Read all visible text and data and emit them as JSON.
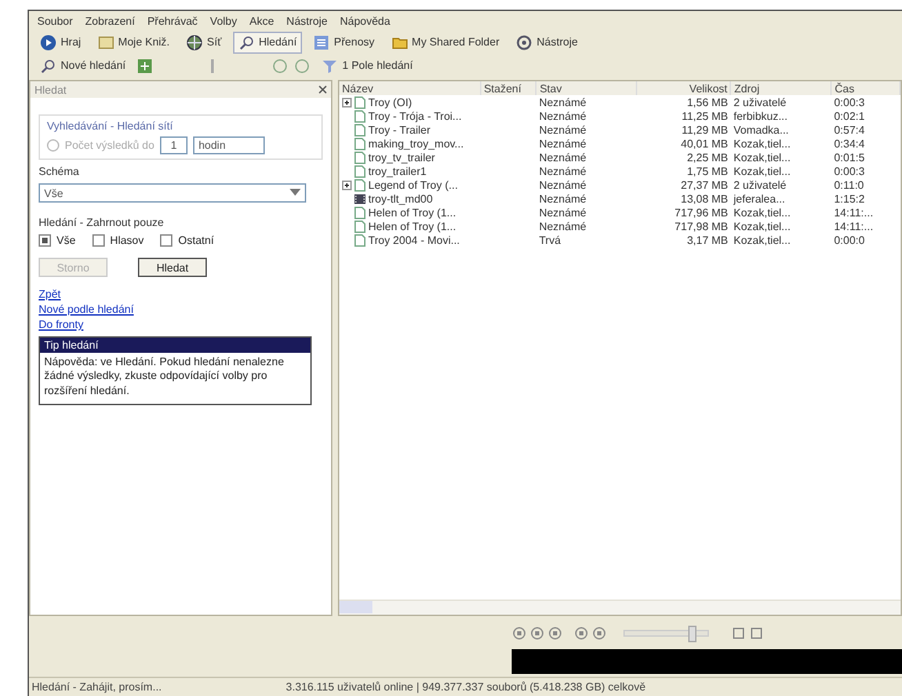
{
  "menu": [
    "Soubor",
    "Zobrazení",
    "Přehrávač",
    "Volby",
    "Akce",
    "Nástroje",
    "Nápověda"
  ],
  "toolbar": [
    {
      "label": "Hraj",
      "selected": false
    },
    {
      "label": "Moje Kniž.",
      "selected": false
    },
    {
      "label": "Síť",
      "selected": false
    },
    {
      "label": "Hledání",
      "selected": true
    },
    {
      "label": "Přenosy",
      "selected": false
    },
    {
      "label": "My Shared Folder",
      "selected": false
    },
    {
      "label": "Nástroje",
      "selected": false
    }
  ],
  "player": {
    "volume": {
      "level": 0.8
    }
  },
  "toolbar2": {
    "new_search": "Nové hledání",
    "filter": "1 Pole hledání"
  },
  "search_panel": {
    "title": "Hledat",
    "options_label": "Vyhledávání - Hledání sítí",
    "radio": {
      "label": "Počet výsledků do",
      "selected": false
    },
    "count": "1",
    "unit": "hodin",
    "schema_label": "Schéma",
    "schema_value": "Vše",
    "filter_label": "Hledání - Zahrnout pouze",
    "checkboxes": [
      {
        "label": "Vše",
        "checked": true
      },
      {
        "label": "Hlasov",
        "checked": false
      },
      {
        "label": "Ostatní",
        "checked": false
      }
    ],
    "buttons": [
      {
        "label": "Storno",
        "disabled": true
      },
      {
        "label": "Hledat",
        "disabled": false
      }
    ],
    "links": [
      "Zpět",
      "Nové podle hledání",
      "Do fronty"
    ],
    "tip": {
      "title": "Tip hledání",
      "text": "Nápověda: ve Hledání. Pokud hledání nenalezne žádné výsledky, zkuste odpovídající volby pro rozšíření hledání."
    }
  },
  "results": {
    "columns": [
      "Název",
      "Stažení",
      "Stav",
      "Velikost",
      "Zdroj",
      "Čas"
    ],
    "rows": [
      {
        "kind": "group",
        "name": "Troy (OI)",
        "status": "Neznámé",
        "size": "1,56 MB",
        "source": "2 uživatelé",
        "time": "0:00:3"
      },
      {
        "kind": "file",
        "name": "Troy - Trója - Troi...",
        "status": "Neznámé",
        "size": "11,25 MB",
        "source": "ferbibkuz...",
        "time": "0:02:1"
      },
      {
        "kind": "file",
        "name": "Troy - Trailer",
        "status": "Neznámé",
        "size": "11,29 MB",
        "source": "Vomadka...",
        "time": "0:57:4"
      },
      {
        "kind": "file",
        "name": "making_troy_mov...",
        "status": "Neznámé",
        "size": "40,01 MB",
        "source": "Kozak,tiel...",
        "time": "0:34:4"
      },
      {
        "kind": "file",
        "name": "troy_tv_trailer",
        "status": "Neznámé",
        "size": "2,25 MB",
        "source": "Kozak,tiel...",
        "time": "0:01:5"
      },
      {
        "kind": "file",
        "name": "troy_trailer1",
        "status": "Neznámé",
        "size": "1,75 MB",
        "source": "Kozak,tiel...",
        "time": "0:00:3"
      },
      {
        "kind": "group",
        "name": "Legend of Troy (...",
        "status": "Neznámé",
        "size": "27,37 MB",
        "source": "2 uživatelé",
        "time": "0:11:0"
      },
      {
        "kind": "video",
        "name": "troy-tlt_md00",
        "status": "Neznámé",
        "size": "13,08 MB",
        "source": "jeferalea...",
        "time": "1:15:2"
      },
      {
        "kind": "file",
        "name": "Helen of Troy (1...",
        "status": "Neznámé",
        "size": "717,96 MB",
        "source": "Kozak,tiel...",
        "time": "14:11:..."
      },
      {
        "kind": "file",
        "name": "Helen of Troy (1...",
        "status": "Neznámé",
        "size": "717,98 MB",
        "source": "Kozak,tiel...",
        "time": "14:11:..."
      },
      {
        "kind": "file",
        "name": "Troy 2004 - Movi...",
        "status": "Trvá",
        "size": "3,17 MB",
        "source": "Kozak,tiel...",
        "time": "0:00:0"
      }
    ]
  },
  "status_bar": {
    "left": "Hledání - Zahájit, prosím...",
    "right": "3.316.115 uživatelů online | 949.377.337 souborů (5.418.238 GB) celkově"
  }
}
